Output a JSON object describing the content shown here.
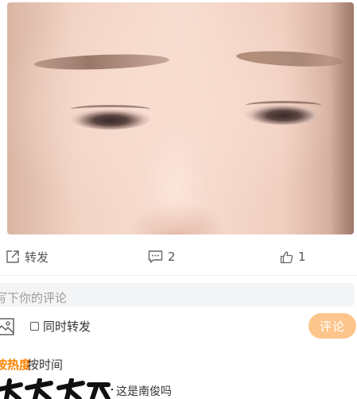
{
  "post": {
    "image_alt": "Close-up photo of a face showing eyes and eyebrows"
  },
  "actions": {
    "forward_label": "转发",
    "comment_count": "2",
    "like_count": "1",
    "forward_icon": "share-icon",
    "comment_icon": "comment-bubble-icon",
    "like_icon": "thumbs-up-icon"
  },
  "composer": {
    "placeholder": "写下你的评论",
    "visible_placeholder": "写下你的评论",
    "image_icon": "image-icon",
    "repost_checkbox_label": "同时转发",
    "submit_label": "评论",
    "submit_color": "#fdc58b"
  },
  "sort": {
    "hot_label": "按热度",
    "time_label": "按时间",
    "hot_color": "#ff8200"
  },
  "comments": [
    {
      "text": "这是南俊吗"
    }
  ]
}
